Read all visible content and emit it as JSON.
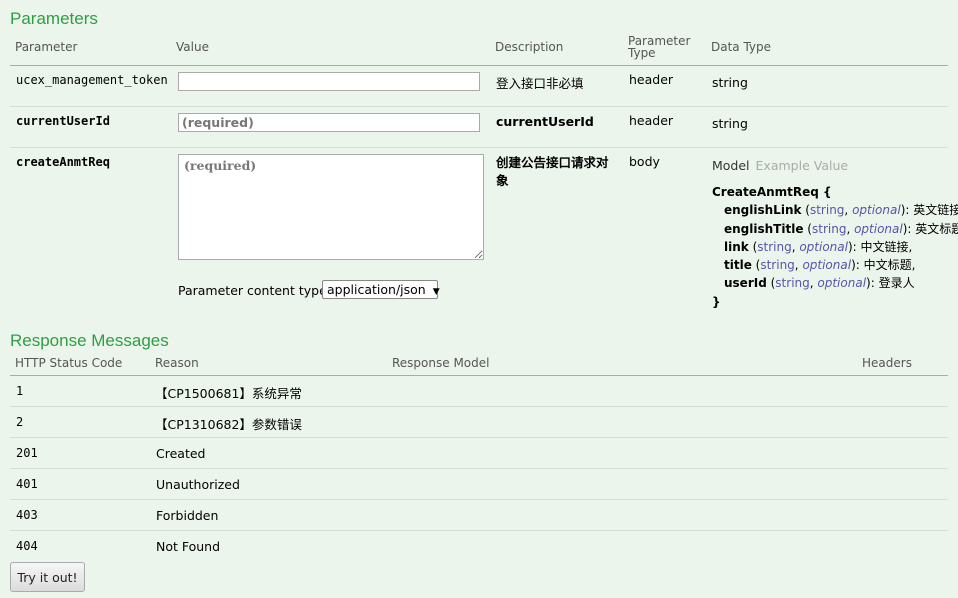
{
  "parameters": {
    "title": "Parameters",
    "headers": {
      "parameter": "Parameter",
      "value": "Value",
      "description": "Description",
      "param_type": "Parameter\nType",
      "data_type": "Data Type"
    },
    "rows": [
      {
        "name": "ucex_management_token",
        "value": "",
        "placeholder": "",
        "description": "登入接口非必填",
        "param_type": "header",
        "data_type": "string"
      },
      {
        "name": "currentUserId",
        "value": "",
        "placeholder": "(required)",
        "description": "currentUserId",
        "param_type": "header",
        "data_type": "string"
      },
      {
        "name": "createAnmtReq",
        "value": "",
        "placeholder": "(required)",
        "description": "创建公告接口请求对象",
        "param_type": "body"
      }
    ],
    "content_type_label": "Parameter content type:",
    "content_type_value": "application/json",
    "model_tab": "Model",
    "example_tab": "Example Value",
    "model": {
      "name": "CreateAnmtReq {",
      "close": "}",
      "props": [
        {
          "name": "englishLink",
          "type": "string",
          "opt": "optional",
          "desc": ": 英文链接,"
        },
        {
          "name": "englishTitle",
          "type": "string",
          "opt": "optional",
          "desc": ": 英文标题,"
        },
        {
          "name": "link",
          "type": "string",
          "opt": "optional",
          "desc": ": 中文链接,"
        },
        {
          "name": "title",
          "type": "string",
          "opt": "optional",
          "desc": ": 中文标题,"
        },
        {
          "name": "userId",
          "type": "string",
          "opt": "optional",
          "desc": ": 登录人"
        }
      ]
    }
  },
  "responses": {
    "title": "Response Messages",
    "headers": {
      "code": "HTTP Status Code",
      "reason": "Reason",
      "model": "Response Model",
      "headers": "Headers"
    },
    "rows": [
      {
        "code": "1",
        "reason": "【CP1500681】系统异常"
      },
      {
        "code": "2",
        "reason": "【CP1310682】参数错误"
      },
      {
        "code": "201",
        "reason": "Created"
      },
      {
        "code": "401",
        "reason": "Unauthorized"
      },
      {
        "code": "403",
        "reason": "Forbidden"
      },
      {
        "code": "404",
        "reason": "Not Found"
      }
    ]
  },
  "try_button": "Try it out!"
}
